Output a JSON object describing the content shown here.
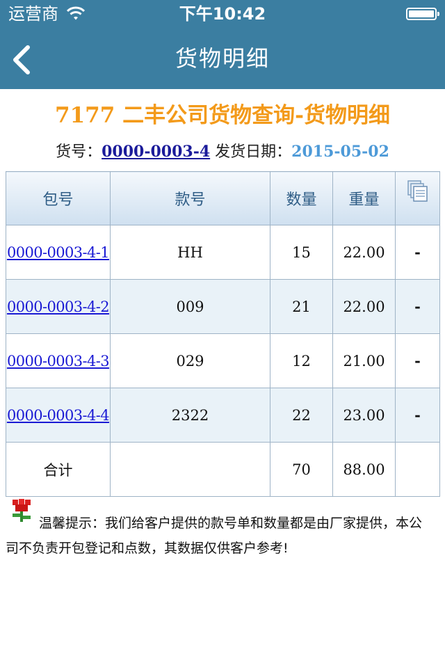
{
  "status_bar": {
    "carrier": "运营商",
    "time": "下午10:42"
  },
  "nav": {
    "title": "货物明细",
    "back_icon": "chevron-left-icon"
  },
  "heading": "7177 二丰公司货物查询-货物明细",
  "shipment": {
    "no_label": "货号：",
    "no_value": "0000-0003-4",
    "date_label": "发货日期：",
    "date_value": "2015-05-02"
  },
  "table": {
    "headers": {
      "pkg": "包号",
      "style": "款号",
      "qty": "数量",
      "weight": "重量",
      "copy_icon": "copy-icon"
    },
    "rows": [
      {
        "pkg": "0000-0003-4-1",
        "style": "HH",
        "qty": "15",
        "weight": "22.00",
        "action": "-"
      },
      {
        "pkg": "0000-0003-4-2",
        "style": "009",
        "qty": "21",
        "weight": "22.00",
        "action": "-"
      },
      {
        "pkg": "0000-0003-4-3",
        "style": "029",
        "qty": "12",
        "weight": "21.00",
        "action": "-"
      },
      {
        "pkg": "0000-0003-4-4",
        "style": "2322",
        "qty": "22",
        "weight": "23.00",
        "action": "-"
      }
    ],
    "total": {
      "label": "合计",
      "style": "",
      "qty": "70",
      "weight": "88.00"
    }
  },
  "tip": {
    "icon": "flower-icon",
    "text": "温馨提示：我们给客户提供的款号单和数量都是由厂家提供，本公司不负责开包登记和点数，其数据仅供客户参考!"
  },
  "colors": {
    "nav_bg": "#3b7ea1",
    "heading": "#f39a1a",
    "link": "#1a1ad4",
    "date": "#4d9ad8",
    "alt_row": "#e9f2f8"
  }
}
